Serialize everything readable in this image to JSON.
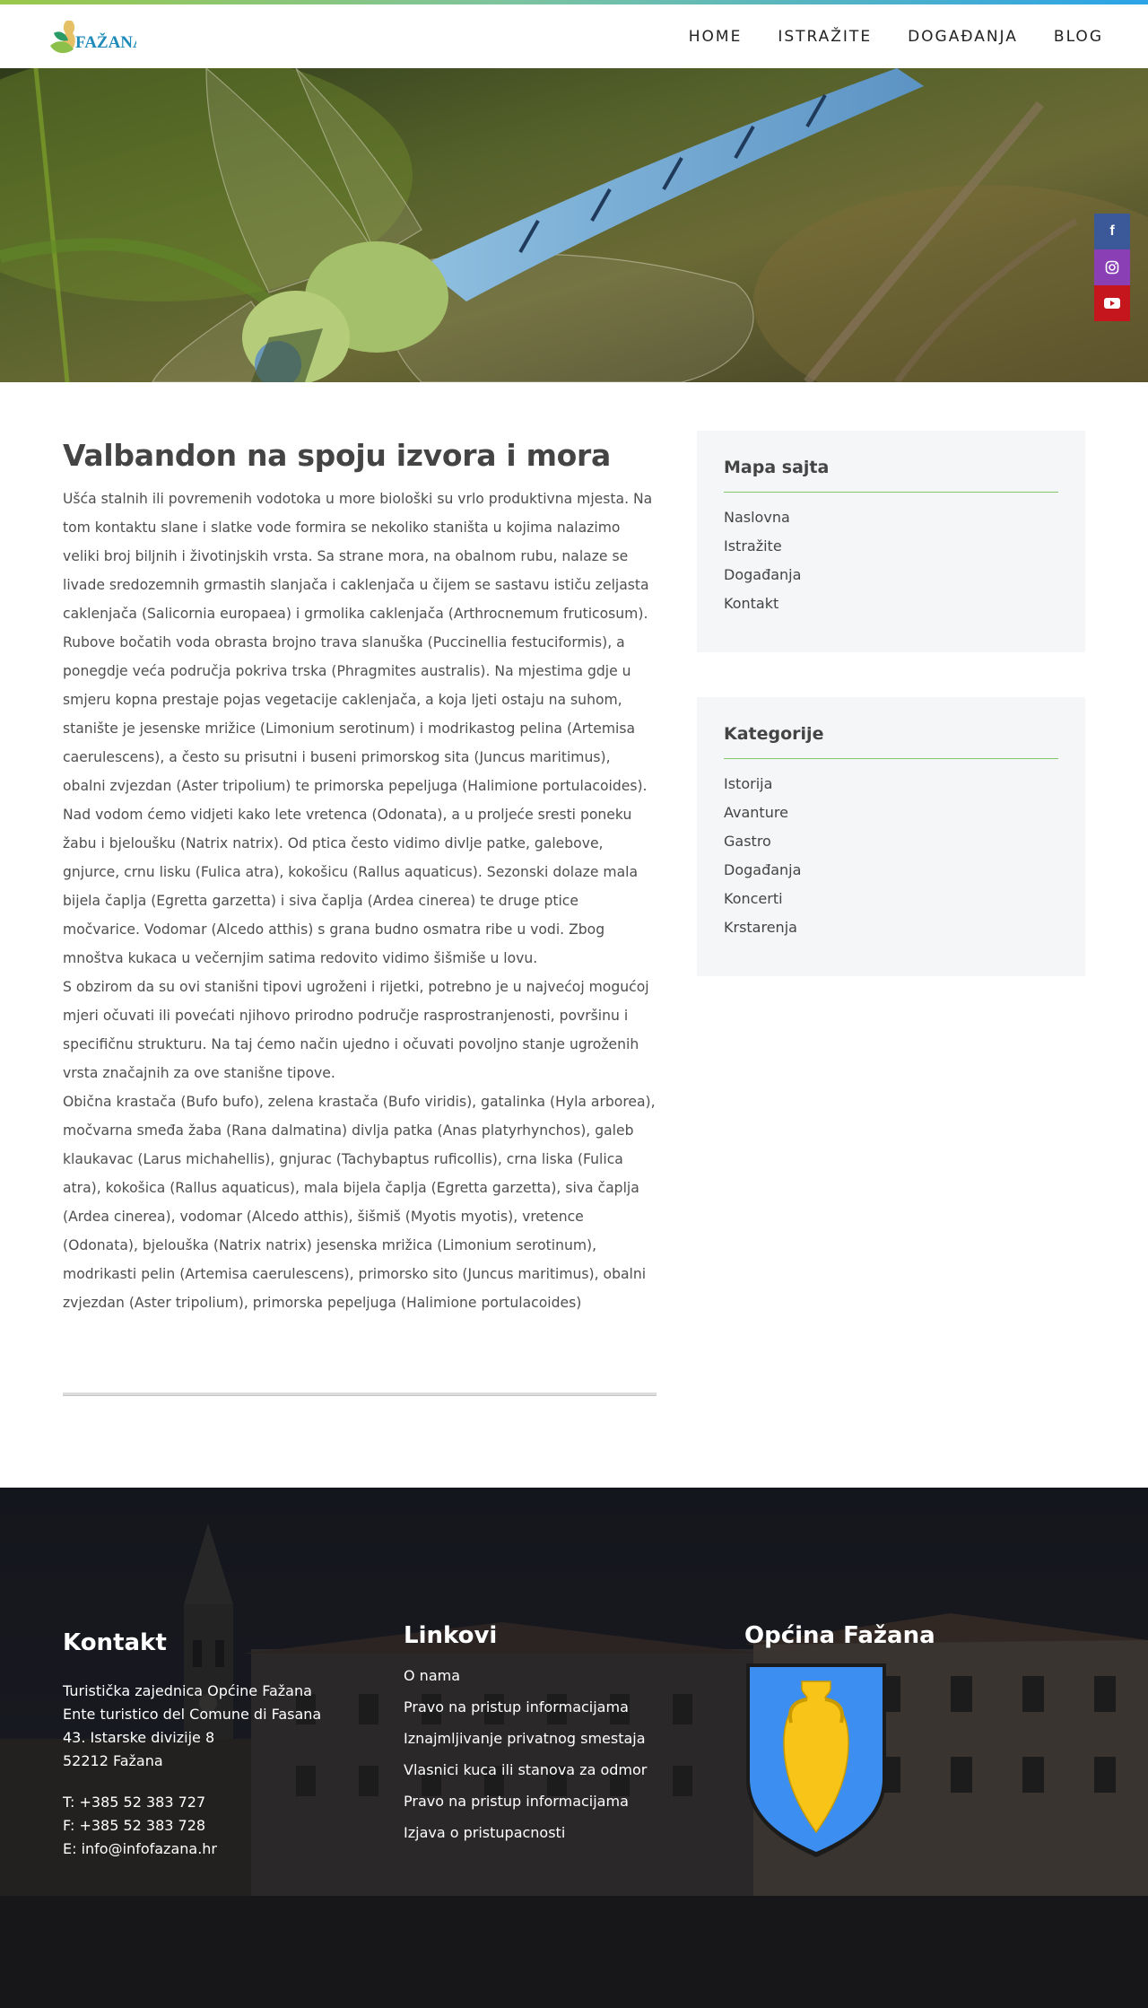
{
  "header": {
    "logo_text": "FAŽANA",
    "nav": [
      "HOME",
      "ISTRAŽITE",
      "DOGAĐANJA",
      "BLOG"
    ]
  },
  "social": {
    "facebook": "f",
    "colors": {
      "facebook": "#3b5998",
      "instagram": "#8b3fb5",
      "youtube": "#c4161c"
    }
  },
  "article": {
    "title": "Valbandon na spoju izvora i mora",
    "paragraphs": [
      "Ušća stalnih ili povremenih vodotoka u more biološki su vrlo produktivna mjesta. Na tom kontaktu slane i slatke vode formira se nekoliko staništa u kojima nalazimo veliki broj biljnih i životinjskih vrsta. Sa strane mora, na obalnom rubu, nalaze se livade sredozemnih grmastih slanjača i caklenjača u čijem se sastavu ističu zeljasta caklenjača (Salicornia europaea) i grmolika caklenjača (Arthrocnemum fruticosum). Rubove bočatih voda obrasta brojno trava slanuška (Puccinellia festuciformis), a ponegdje veća područja pokriva trska (Phragmites australis). Na mjestima gdje u smjeru kopna prestaje pojas vegetacije caklenjača, a koja ljeti ostaju na suhom, stanište je jesenske mrižice (Limonium serotinum) i modrikastog pelina (Artemisa caerulescens), a često su prisutni i buseni primorskog sita (Juncus maritimus), obalni zvjezdan (Aster tripolium) te primorska pepeljuga (Halimione portulacoides).",
      "Nad vodom ćemo vidjeti kako lete vretenca (Odonata), a u proljeće sresti poneku žabu i bjeloušku (Natrix natrix). Od ptica često vidimo divlje patke, galebove, gnjurce, crnu lisku (Fulica atra), kokošicu (Rallus aquaticus). Sezonski dolaze mala bijela čaplja (Egretta garzetta) i siva čaplja (Ardea cinerea) te druge ptice močvarice. Vodomar (Alcedo atthis) s grana budno osmatra ribe u vodi. Zbog mnoštva kukaca u večernjim satima redovito vidimo šišmiše u lovu.",
      "S obzirom da su ovi stanišni tipovi ugroženi i rijetki, potrebno je u najvećoj mogućoj mjeri očuvati ili povećati njihovo prirodno područje rasprostranjenosti, površinu i specifičnu strukturu. Na taj ćemo način ujedno i očuvati povoljno stanje ugroženih vrsta značajnih za ove stanišne tipove.",
      "Obična krastača (Bufo bufo), zelena krastača (Bufo viridis), gatalinka (Hyla arborea), močvarna smeđa žaba (Rana dalmatina) divlja patka (Anas platyrhynchos), galeb klaukavac (Larus michahellis), gnjurac (Tachybaptus ruficollis), crna liska (Fulica atra), kokošica (Rallus aquaticus), mala bijela čaplja (Egretta garzetta), siva čaplja (Ardea cinerea), vodomar (Alcedo atthis), šišmiš (Myotis myotis), vretence (Odonata), bjelouška (Natrix natrix) jesenska mrižica (Limonium serotinum), modrikasti pelin (Artemisa caerulescens), primorsko sito (Juncus maritimus), obalni zvjezdan (Aster tripolium), primorska pepeljuga (Halimione portulacoides)"
    ]
  },
  "sidebar": {
    "sitemap": {
      "title": "Mapa sajta",
      "items": [
        "Naslovna",
        "Istražite",
        "Događanja",
        "Kontakt"
      ]
    },
    "categories": {
      "title": "Kategorije",
      "items": [
        "Istorija",
        "Avanture",
        "Gastro",
        "Događanja",
        "Koncerti",
        "Krstarenja"
      ]
    }
  },
  "footer": {
    "contact": {
      "title": "Kontakt",
      "address": [
        "Turistička zajednica Općine Fažana",
        "Ente turistico del Comune di Fasana",
        "43. Istarske divizije 8",
        "52212 Fažana"
      ],
      "phone": "T: +385 52 383 727",
      "fax": "F: +385 52 383 728",
      "email": "E: info@infofazana.hr"
    },
    "links": {
      "title": "Linkovi",
      "items": [
        "O nama",
        "Pravo na pristup informacijama",
        "Iznajmljivanje privatnog smestaja",
        "Vlasnici kuca ili stanova za odmor",
        "Pravo na pristup informacijama",
        "Izjava o pristupacnosti"
      ]
    },
    "municipality": {
      "title": "Općina Fažana"
    }
  }
}
